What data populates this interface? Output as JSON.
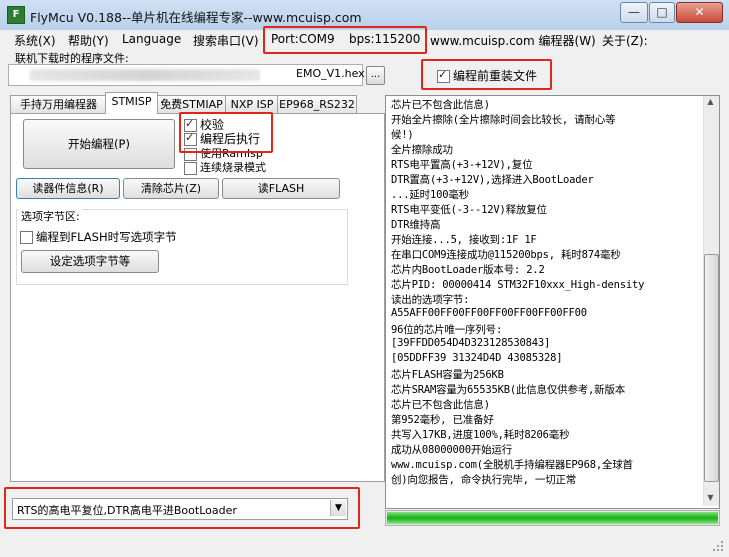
{
  "window": {
    "title": "FlyMcu V0.188--单片机在线编程专家--www.mcuisp.com",
    "icon": "flymcu-app-icon",
    "minimize_glyph": "—",
    "maximize_glyph": "□",
    "close_glyph": "✕"
  },
  "menu": {
    "items": [
      "系统(X)",
      "帮助(Y)",
      "Language",
      "搜索串口(V)",
      "Port:COM9",
      "bps:115200",
      "www.mcuisp.com 编程器(W)",
      "关于(Z):"
    ]
  },
  "file": {
    "label": "联机下载时的程序文件:",
    "name": "EMO_V1.hex",
    "browse_label": "..."
  },
  "options": {
    "reload_before_program": {
      "label": "编程前重装文件",
      "checked": true
    },
    "verify": {
      "label": "校验",
      "checked": true
    },
    "run_after_program": {
      "label": "编程后执行",
      "checked": true
    },
    "use_ramisp": {
      "label": "使用RamIsp",
      "checked": false
    },
    "continuous_mode": {
      "label": "连续烧录模式",
      "checked": false
    }
  },
  "tabs": [
    "手持万用编程器",
    "STMISP",
    "免费STMIAP",
    "NXP ISP",
    "EP968_RS232"
  ],
  "buttons": {
    "start_program": "开始编程(P)",
    "read_info": "读器件信息(R)",
    "erase_chip": "清除芯片(Z)",
    "read_flash": "读FLASH"
  },
  "option_bytes": {
    "group_label": "选项字节区:",
    "write_to_flash": {
      "label": "编程到FLASH时写选项字节",
      "checked": false
    },
    "set_button": "设定选项字节等"
  },
  "log_lines": [
    "芯片已不包含此信息)",
    "开始全片擦除(全片擦除时间会比较长, 请耐心等",
    "候!)",
    "全片擦除成功",
    "RTS电平置高(+3-+12V),复位",
    "DTR置高(+3-+12V),选择进入BootLoader",
    "...延时100毫秒",
    "RTS电平变低(-3--12V)释放复位",
    "DTR维持高",
    "开始连接...5, 接收到:1F 1F",
    "在串口COM9连接成功@115200bps, 耗时874毫秒",
    "芯片内BootLoader版本号: 2.2",
    "芯片PID: 00000414  STM32F10xxx_High-density",
    "读出的选项字节:",
    "A55AFF00FF00FF00FF00FF00FF00FF00",
    "96位的芯片唯一序列号:",
    "[39FFDD054D4D323128530843]",
    "[05DDFF39 31324D4D 43085328]",
    "芯片FLASH容量为256KB",
    "芯片SRAM容量为65535KB(此信息仅供参考,新版本",
    "芯片已不包含此信息)",
    "第952毫秒, 已准备好",
    "共写入17KB,进度100%,耗时8206毫秒",
    "成功从08000000开始运行",
    "www.mcuisp.com(全脱机手持编程器EP968,全球首",
    "创)向您报告, 命令执行完毕, 一切正常"
  ],
  "progress": {
    "fraction": 1.0,
    "color": "#16b016"
  },
  "reset_mode": {
    "selected": "RTS的高电平复位,DTR高电平进BootLoader"
  },
  "colors": {
    "highlight_box": "#e0261a",
    "title_bar": "#b9d1ea"
  }
}
